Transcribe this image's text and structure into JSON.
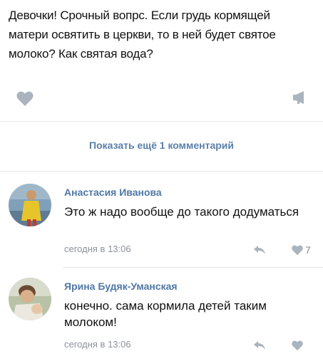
{
  "post": {
    "text": "Девочки! Срочный вопрс. Если грудь кормящей матери освятить в церкви, то в ней будет святое молоко? Как святая вода?"
  },
  "icons": {
    "like": "heart-icon",
    "share": "megaphone-icon",
    "reply": "reply-arrow-icon"
  },
  "colors": {
    "link": "#5a7fa8",
    "author": "#4f77a5",
    "icon": "#aab4be",
    "meta": "#8a939c"
  },
  "more_comments_label": "Показать ещё 1 комментарий",
  "comments": [
    {
      "author": "Анастасия Иванова",
      "text": "Это ж надо вообще до такого додуматься",
      "time": "сегодня в 13:06",
      "likes": "7"
    },
    {
      "author": "Ярина Будяк-Уманская",
      "text": "конечно. сама кормила детей таким молоком!",
      "time": "сегодня в 13:06"
    }
  ]
}
